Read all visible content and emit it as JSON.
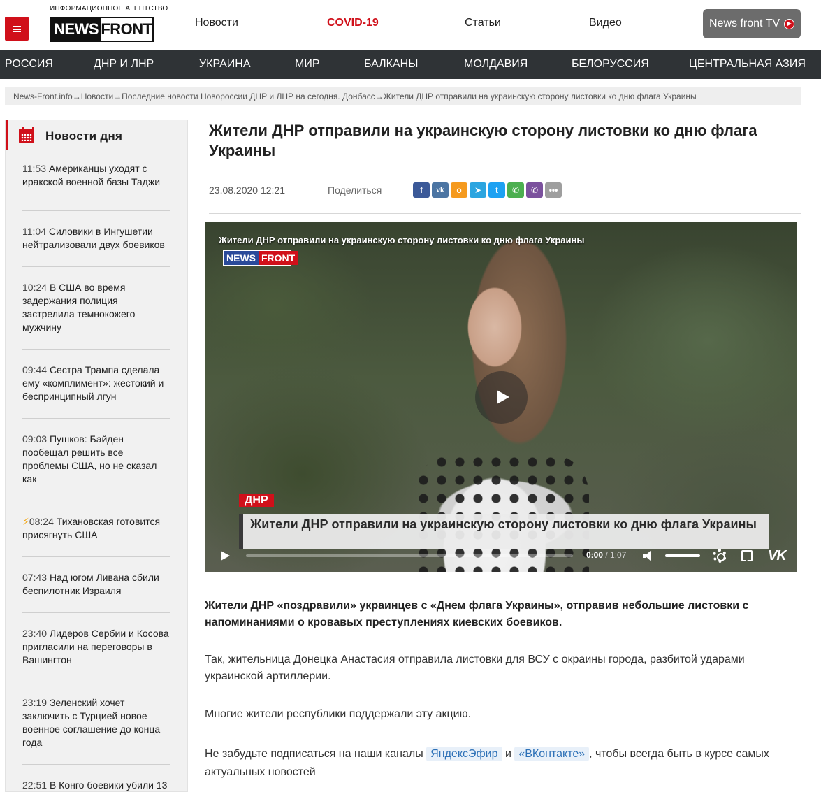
{
  "header": {
    "logo_top": "ИНФОРМАЦИОННОЕ АГЕНТСТВО",
    "logo_news": "NEWS",
    "logo_front": "FRONT",
    "nav": [
      "Новости",
      "COVID-19",
      "Статьи",
      "Видео"
    ],
    "tv_button": "News front TV"
  },
  "categories": [
    "РОССИЯ",
    "ДНР И ЛНР",
    "УКРАИНА",
    "МИР",
    "БАЛКАНЫ",
    "МОЛДАВИЯ",
    "БЕЛОРУССИЯ",
    "ЦЕНТРАЛЬНАЯ АЗИЯ"
  ],
  "breadcrumb": "News-Front.info→Новости→Последние новости Новороссии ДНР и ЛНР на сегодня. Донбасс→Жители ДНР отправили на украинскую сторону листовки ко дню флага Украины",
  "sidebar": {
    "title": "Новости дня",
    "items": [
      {
        "time": "11:53",
        "text": "Американцы уходят с иракской военной базы Таджи"
      },
      {
        "time": "11:04",
        "text": "Силовики в Ингушетии нейтрализовали двух боевиков"
      },
      {
        "time": "10:24",
        "text": "В США во время задержания полиция застрелила темнокожего мужчину"
      },
      {
        "time": "09:44",
        "text": "Сестра Трампа сделала ему «комплимент»: жестокий и беспринципный лгун"
      },
      {
        "time": "09:03",
        "text": "Пушков: Байден пообещал решить все проблемы США, но не сказал как"
      },
      {
        "time": "08:24",
        "text": "Тихановская готовится присягнуть США"
      },
      {
        "time": "07:43",
        "text": "Над югом Ливана сбили беспилотник Израиля"
      },
      {
        "time": "23:40",
        "text": "Лидеров Сербии и Косова пригласили на переговоры в Вашингтон"
      },
      {
        "time": "23:19",
        "text": "Зеленский хочет заключить с Турцией новое военное соглашение до конца года"
      },
      {
        "time": "22:51",
        "text": "В Конго боевики убили 13"
      }
    ]
  },
  "article": {
    "title": "Жители ДНР отправили на украинскую сторону листовки ко дню флага Украины",
    "date": "23.08.2020 12:21",
    "share_label": "Поделиться",
    "share_icons": [
      "facebook-icon",
      "vk-icon",
      "odnoklassniki-icon",
      "telegram-icon",
      "twitter-icon",
      "whatsapp-icon",
      "viber-icon",
      "more-icon"
    ],
    "video": {
      "title": "Жители ДНР отправили на украинскую сторону листовки ко дню флага Украины",
      "logo_news": "NEWS",
      "logo_front": "FRONT",
      "tag": "ДНР",
      "caption": "Жители ДНР отправили на украинскую сторону листовки ко дню флага Украины",
      "current_time": "0:00",
      "duration": "/ 1:07"
    },
    "lead": "Жители ДНР «поздравили» украинцев с «Днем флага Украины», отправив небольшие листовки с напоминаниями о кровавых преступлениях киевских боевиков.",
    "para1": "Так, жительница Донецка Анастасия отправила листовки для ВСУ с окраины города, разбитой ударами украинской артиллерии.",
    "para2": "Многие жители республики поддержали эту акцию.",
    "subscribe": {
      "before": "Не забудьте подписаться на наши каналы ",
      "link1": "ЯндексЭфир",
      "mid": " и ",
      "link2": "«ВКонтакте»",
      "after": ", чтобы всегда быть в курсе самых актуальных новостей"
    }
  },
  "colors": {
    "accent": "#d0101a",
    "nav_bg": "#2f3336",
    "link": "#2e71b7"
  }
}
